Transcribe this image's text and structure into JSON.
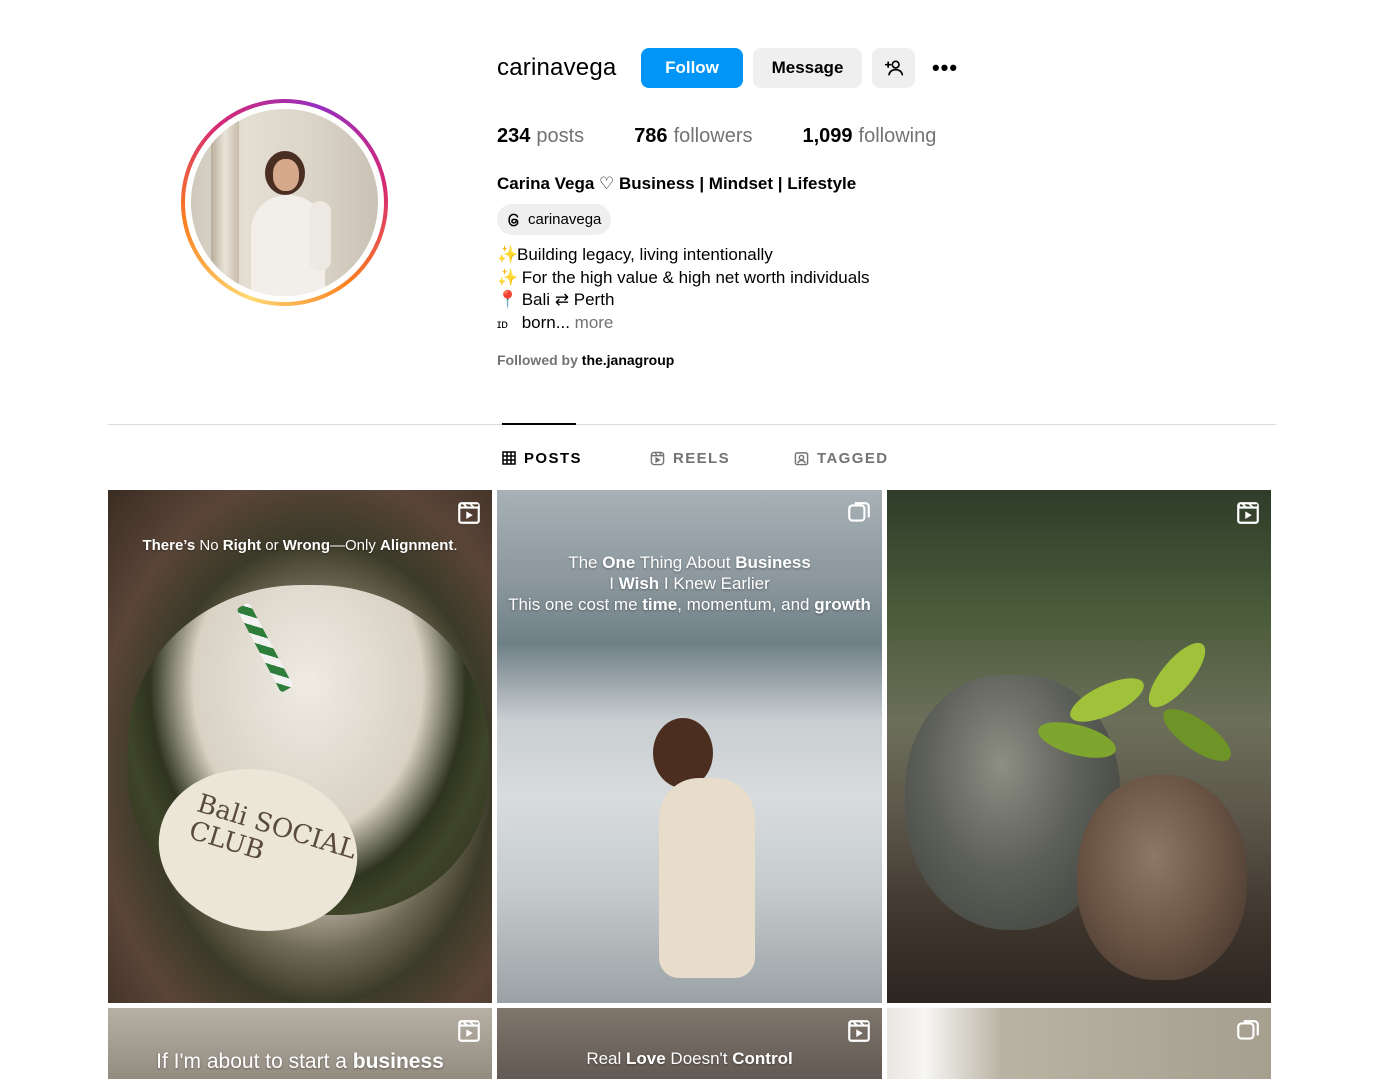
{
  "profile": {
    "username": "carinavega",
    "follow_label": "Follow",
    "message_label": "Message",
    "more_label": "•••",
    "stats": {
      "posts_count": "234",
      "posts_label": "posts",
      "followers_count": "786",
      "followers_label": "followers",
      "following_count": "1,099",
      "following_label": "following"
    },
    "full_name": "Carina Vega ♡ Business | Mindset | Lifestyle",
    "threads_handle": "carinavega",
    "bio": {
      "line1_emoji": "✨",
      "line1": "Building legacy, living intentionally",
      "line2_emoji": "✨",
      "line2": " For the high value & high net worth individuals",
      "line3_emoji": "📍",
      "line3": " Bali ⇄ Perth",
      "line4_emoji": "ɪᴅ",
      "line4": " born...",
      "more": "more"
    },
    "followed_by_prefix": "Followed by",
    "followed_by_account": "the.janagroup"
  },
  "tabs": [
    {
      "label": "POSTS",
      "icon": "grid-icon",
      "active": true
    },
    {
      "label": "REELS",
      "icon": "reels-icon",
      "active": false
    },
    {
      "label": "TAGGED",
      "icon": "tagged-icon",
      "active": false
    }
  ],
  "posts": [
    {
      "type": "reel",
      "caption_parts": [
        "There’s",
        " No ",
        "Right",
        " or ",
        "Wrong",
        "—Only ",
        "Alignment",
        "."
      ],
      "badge": "reel-icon"
    },
    {
      "type": "carousel",
      "caption_lines": [
        [
          "The ",
          "One",
          " Thing About ",
          "Business"
        ],
        [
          "I ",
          "Wish",
          " I Knew Earlier"
        ],
        [
          "This one cost me ",
          "time",
          ", momentum, and ",
          "growth"
        ]
      ],
      "badge": "carousel-icon"
    },
    {
      "type": "reel",
      "caption": "",
      "badge": "reel-icon"
    },
    {
      "type": "reel",
      "caption_parts": [
        "If I'm about to start a ",
        "business"
      ],
      "badge": "reel-icon"
    },
    {
      "type": "reel",
      "caption_parts": [
        "Real ",
        "Love",
        " Doesn't ",
        "Control"
      ],
      "badge": "reel-icon"
    },
    {
      "type": "carousel",
      "caption": "",
      "badge": "carousel-icon"
    }
  ],
  "coconut_label": "Bali SOCIAL CLUB",
  "colors": {
    "primary_blue": "#0095f6",
    "secondary_gray": "#efefef",
    "muted_text": "#737373",
    "divider": "#dbdbdb"
  }
}
